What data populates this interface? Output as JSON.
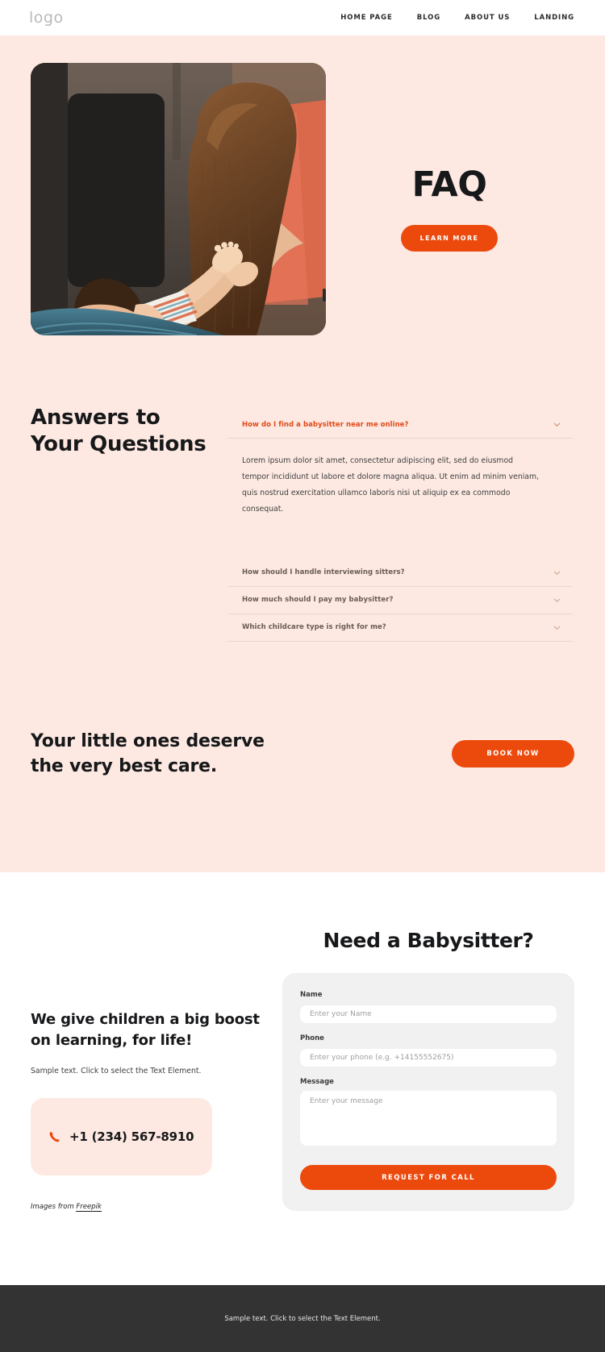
{
  "nav": {
    "logo": "logo",
    "links": [
      "HOME PAGE",
      "BLOG",
      "ABOUT US",
      "LANDING"
    ]
  },
  "hero": {
    "photo_alt": "mother playing with baby",
    "title": "FAQ",
    "cta_label": "LEARN MORE"
  },
  "faq": {
    "heading_line1": "Answers to",
    "heading_line2": "Your Questions",
    "items": [
      {
        "question": "How do I find a babysitter near me online?",
        "answer": "Lorem ipsum dolor sit amet, consectetur adipiscing elit, sed do eiusmod tempor incididunt ut labore et dolore magna aliqua. Ut enim ad minim veniam, quis nostrud exercitation ullamco laboris nisi ut aliquip ex ea commodo consequat.",
        "open": true
      },
      {
        "question": "How should I handle interviewing sitters?",
        "answer": "",
        "open": false
      },
      {
        "question": "How much should I pay my babysitter?",
        "answer": "",
        "open": false
      },
      {
        "question": "Which childcare type is right for me?",
        "answer": "",
        "open": false
      }
    ]
  },
  "cta": {
    "line1": "Your little ones deserve",
    "line2": "the very best care.",
    "button": "BOOK NOW"
  },
  "contact": {
    "left_heading_line1": "We give children a big boost on",
    "left_heading_line2": "learning, for life!",
    "sample_text": "Sample text. Click to select the Text Element.",
    "phone": "+1 (234) 567-8910",
    "credit_prefix": "Images from ",
    "credit_link": "Freepik",
    "form_title": "Need a Babysitter?",
    "fields": {
      "name_label": "Name",
      "name_placeholder": "Enter your Name",
      "name_value": "",
      "phone_label": "Phone",
      "phone_placeholder": "Enter your phone (e.g. +14155552675)",
      "phone_value": "",
      "message_label": "Message",
      "message_placeholder": "Enter your message",
      "message_value": ""
    },
    "submit_label": "REQUEST FOR CALL"
  },
  "footer": {
    "text": "Sample text. Click to select the Text Element."
  },
  "colors": {
    "accent": "#ec4a0d",
    "peach": "#fde9e2",
    "dark": "#333333",
    "heading": "#17181a"
  }
}
